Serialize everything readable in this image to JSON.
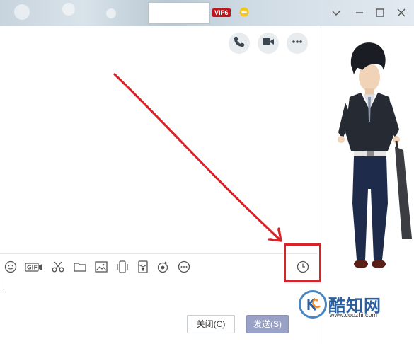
{
  "titlebar": {
    "vip_label": "VIP6",
    "window_controls": [
      "chevron-down-icon",
      "minimize-icon",
      "maximize-icon",
      "close-icon"
    ]
  },
  "header_actions": [
    "phone-icon",
    "video-icon",
    "more-icon"
  ],
  "toolbar": {
    "tools": [
      "emoji-icon",
      "gif-icon",
      "scissors-icon",
      "folder-icon",
      "image-icon",
      "shake-icon",
      "red-packet-icon",
      "music-icon",
      "more-circle-icon",
      "clock-icon"
    ],
    "gif_text": "GIF"
  },
  "buttons": {
    "close_label": "关闭(C)",
    "send_label": "发送(S)"
  },
  "watermark": {
    "brand": "酷知网",
    "url": "www.coozhi.com"
  },
  "colors": {
    "annotation": "#d8232a",
    "send_button": "#9aa1c6",
    "vip": "#c3161c"
  }
}
